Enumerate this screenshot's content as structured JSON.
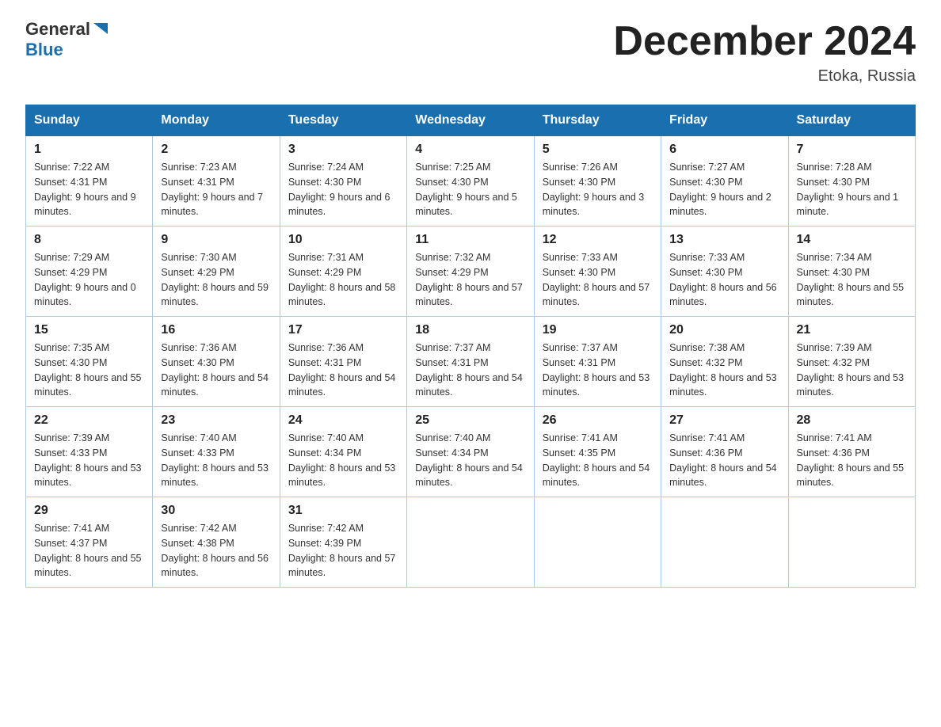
{
  "logo": {
    "general": "General",
    "blue": "Blue"
  },
  "title": {
    "month_year": "December 2024",
    "location": "Etoka, Russia"
  },
  "headers": [
    "Sunday",
    "Monday",
    "Tuesday",
    "Wednesday",
    "Thursday",
    "Friday",
    "Saturday"
  ],
  "weeks": [
    [
      {
        "day": "1",
        "sunrise": "Sunrise: 7:22 AM",
        "sunset": "Sunset: 4:31 PM",
        "daylight": "Daylight: 9 hours and 9 minutes."
      },
      {
        "day": "2",
        "sunrise": "Sunrise: 7:23 AM",
        "sunset": "Sunset: 4:31 PM",
        "daylight": "Daylight: 9 hours and 7 minutes."
      },
      {
        "day": "3",
        "sunrise": "Sunrise: 7:24 AM",
        "sunset": "Sunset: 4:30 PM",
        "daylight": "Daylight: 9 hours and 6 minutes."
      },
      {
        "day": "4",
        "sunrise": "Sunrise: 7:25 AM",
        "sunset": "Sunset: 4:30 PM",
        "daylight": "Daylight: 9 hours and 5 minutes."
      },
      {
        "day": "5",
        "sunrise": "Sunrise: 7:26 AM",
        "sunset": "Sunset: 4:30 PM",
        "daylight": "Daylight: 9 hours and 3 minutes."
      },
      {
        "day": "6",
        "sunrise": "Sunrise: 7:27 AM",
        "sunset": "Sunset: 4:30 PM",
        "daylight": "Daylight: 9 hours and 2 minutes."
      },
      {
        "day": "7",
        "sunrise": "Sunrise: 7:28 AM",
        "sunset": "Sunset: 4:30 PM",
        "daylight": "Daylight: 9 hours and 1 minute."
      }
    ],
    [
      {
        "day": "8",
        "sunrise": "Sunrise: 7:29 AM",
        "sunset": "Sunset: 4:29 PM",
        "daylight": "Daylight: 9 hours and 0 minutes."
      },
      {
        "day": "9",
        "sunrise": "Sunrise: 7:30 AM",
        "sunset": "Sunset: 4:29 PM",
        "daylight": "Daylight: 8 hours and 59 minutes."
      },
      {
        "day": "10",
        "sunrise": "Sunrise: 7:31 AM",
        "sunset": "Sunset: 4:29 PM",
        "daylight": "Daylight: 8 hours and 58 minutes."
      },
      {
        "day": "11",
        "sunrise": "Sunrise: 7:32 AM",
        "sunset": "Sunset: 4:29 PM",
        "daylight": "Daylight: 8 hours and 57 minutes."
      },
      {
        "day": "12",
        "sunrise": "Sunrise: 7:33 AM",
        "sunset": "Sunset: 4:30 PM",
        "daylight": "Daylight: 8 hours and 57 minutes."
      },
      {
        "day": "13",
        "sunrise": "Sunrise: 7:33 AM",
        "sunset": "Sunset: 4:30 PM",
        "daylight": "Daylight: 8 hours and 56 minutes."
      },
      {
        "day": "14",
        "sunrise": "Sunrise: 7:34 AM",
        "sunset": "Sunset: 4:30 PM",
        "daylight": "Daylight: 8 hours and 55 minutes."
      }
    ],
    [
      {
        "day": "15",
        "sunrise": "Sunrise: 7:35 AM",
        "sunset": "Sunset: 4:30 PM",
        "daylight": "Daylight: 8 hours and 55 minutes."
      },
      {
        "day": "16",
        "sunrise": "Sunrise: 7:36 AM",
        "sunset": "Sunset: 4:30 PM",
        "daylight": "Daylight: 8 hours and 54 minutes."
      },
      {
        "day": "17",
        "sunrise": "Sunrise: 7:36 AM",
        "sunset": "Sunset: 4:31 PM",
        "daylight": "Daylight: 8 hours and 54 minutes."
      },
      {
        "day": "18",
        "sunrise": "Sunrise: 7:37 AM",
        "sunset": "Sunset: 4:31 PM",
        "daylight": "Daylight: 8 hours and 54 minutes."
      },
      {
        "day": "19",
        "sunrise": "Sunrise: 7:37 AM",
        "sunset": "Sunset: 4:31 PM",
        "daylight": "Daylight: 8 hours and 53 minutes."
      },
      {
        "day": "20",
        "sunrise": "Sunrise: 7:38 AM",
        "sunset": "Sunset: 4:32 PM",
        "daylight": "Daylight: 8 hours and 53 minutes."
      },
      {
        "day": "21",
        "sunrise": "Sunrise: 7:39 AM",
        "sunset": "Sunset: 4:32 PM",
        "daylight": "Daylight: 8 hours and 53 minutes."
      }
    ],
    [
      {
        "day": "22",
        "sunrise": "Sunrise: 7:39 AM",
        "sunset": "Sunset: 4:33 PM",
        "daylight": "Daylight: 8 hours and 53 minutes."
      },
      {
        "day": "23",
        "sunrise": "Sunrise: 7:40 AM",
        "sunset": "Sunset: 4:33 PM",
        "daylight": "Daylight: 8 hours and 53 minutes."
      },
      {
        "day": "24",
        "sunrise": "Sunrise: 7:40 AM",
        "sunset": "Sunset: 4:34 PM",
        "daylight": "Daylight: 8 hours and 53 minutes."
      },
      {
        "day": "25",
        "sunrise": "Sunrise: 7:40 AM",
        "sunset": "Sunset: 4:34 PM",
        "daylight": "Daylight: 8 hours and 54 minutes."
      },
      {
        "day": "26",
        "sunrise": "Sunrise: 7:41 AM",
        "sunset": "Sunset: 4:35 PM",
        "daylight": "Daylight: 8 hours and 54 minutes."
      },
      {
        "day": "27",
        "sunrise": "Sunrise: 7:41 AM",
        "sunset": "Sunset: 4:36 PM",
        "daylight": "Daylight: 8 hours and 54 minutes."
      },
      {
        "day": "28",
        "sunrise": "Sunrise: 7:41 AM",
        "sunset": "Sunset: 4:36 PM",
        "daylight": "Daylight: 8 hours and 55 minutes."
      }
    ],
    [
      {
        "day": "29",
        "sunrise": "Sunrise: 7:41 AM",
        "sunset": "Sunset: 4:37 PM",
        "daylight": "Daylight: 8 hours and 55 minutes."
      },
      {
        "day": "30",
        "sunrise": "Sunrise: 7:42 AM",
        "sunset": "Sunset: 4:38 PM",
        "daylight": "Daylight: 8 hours and 56 minutes."
      },
      {
        "day": "31",
        "sunrise": "Sunrise: 7:42 AM",
        "sunset": "Sunset: 4:39 PM",
        "daylight": "Daylight: 8 hours and 57 minutes."
      },
      null,
      null,
      null,
      null
    ]
  ]
}
